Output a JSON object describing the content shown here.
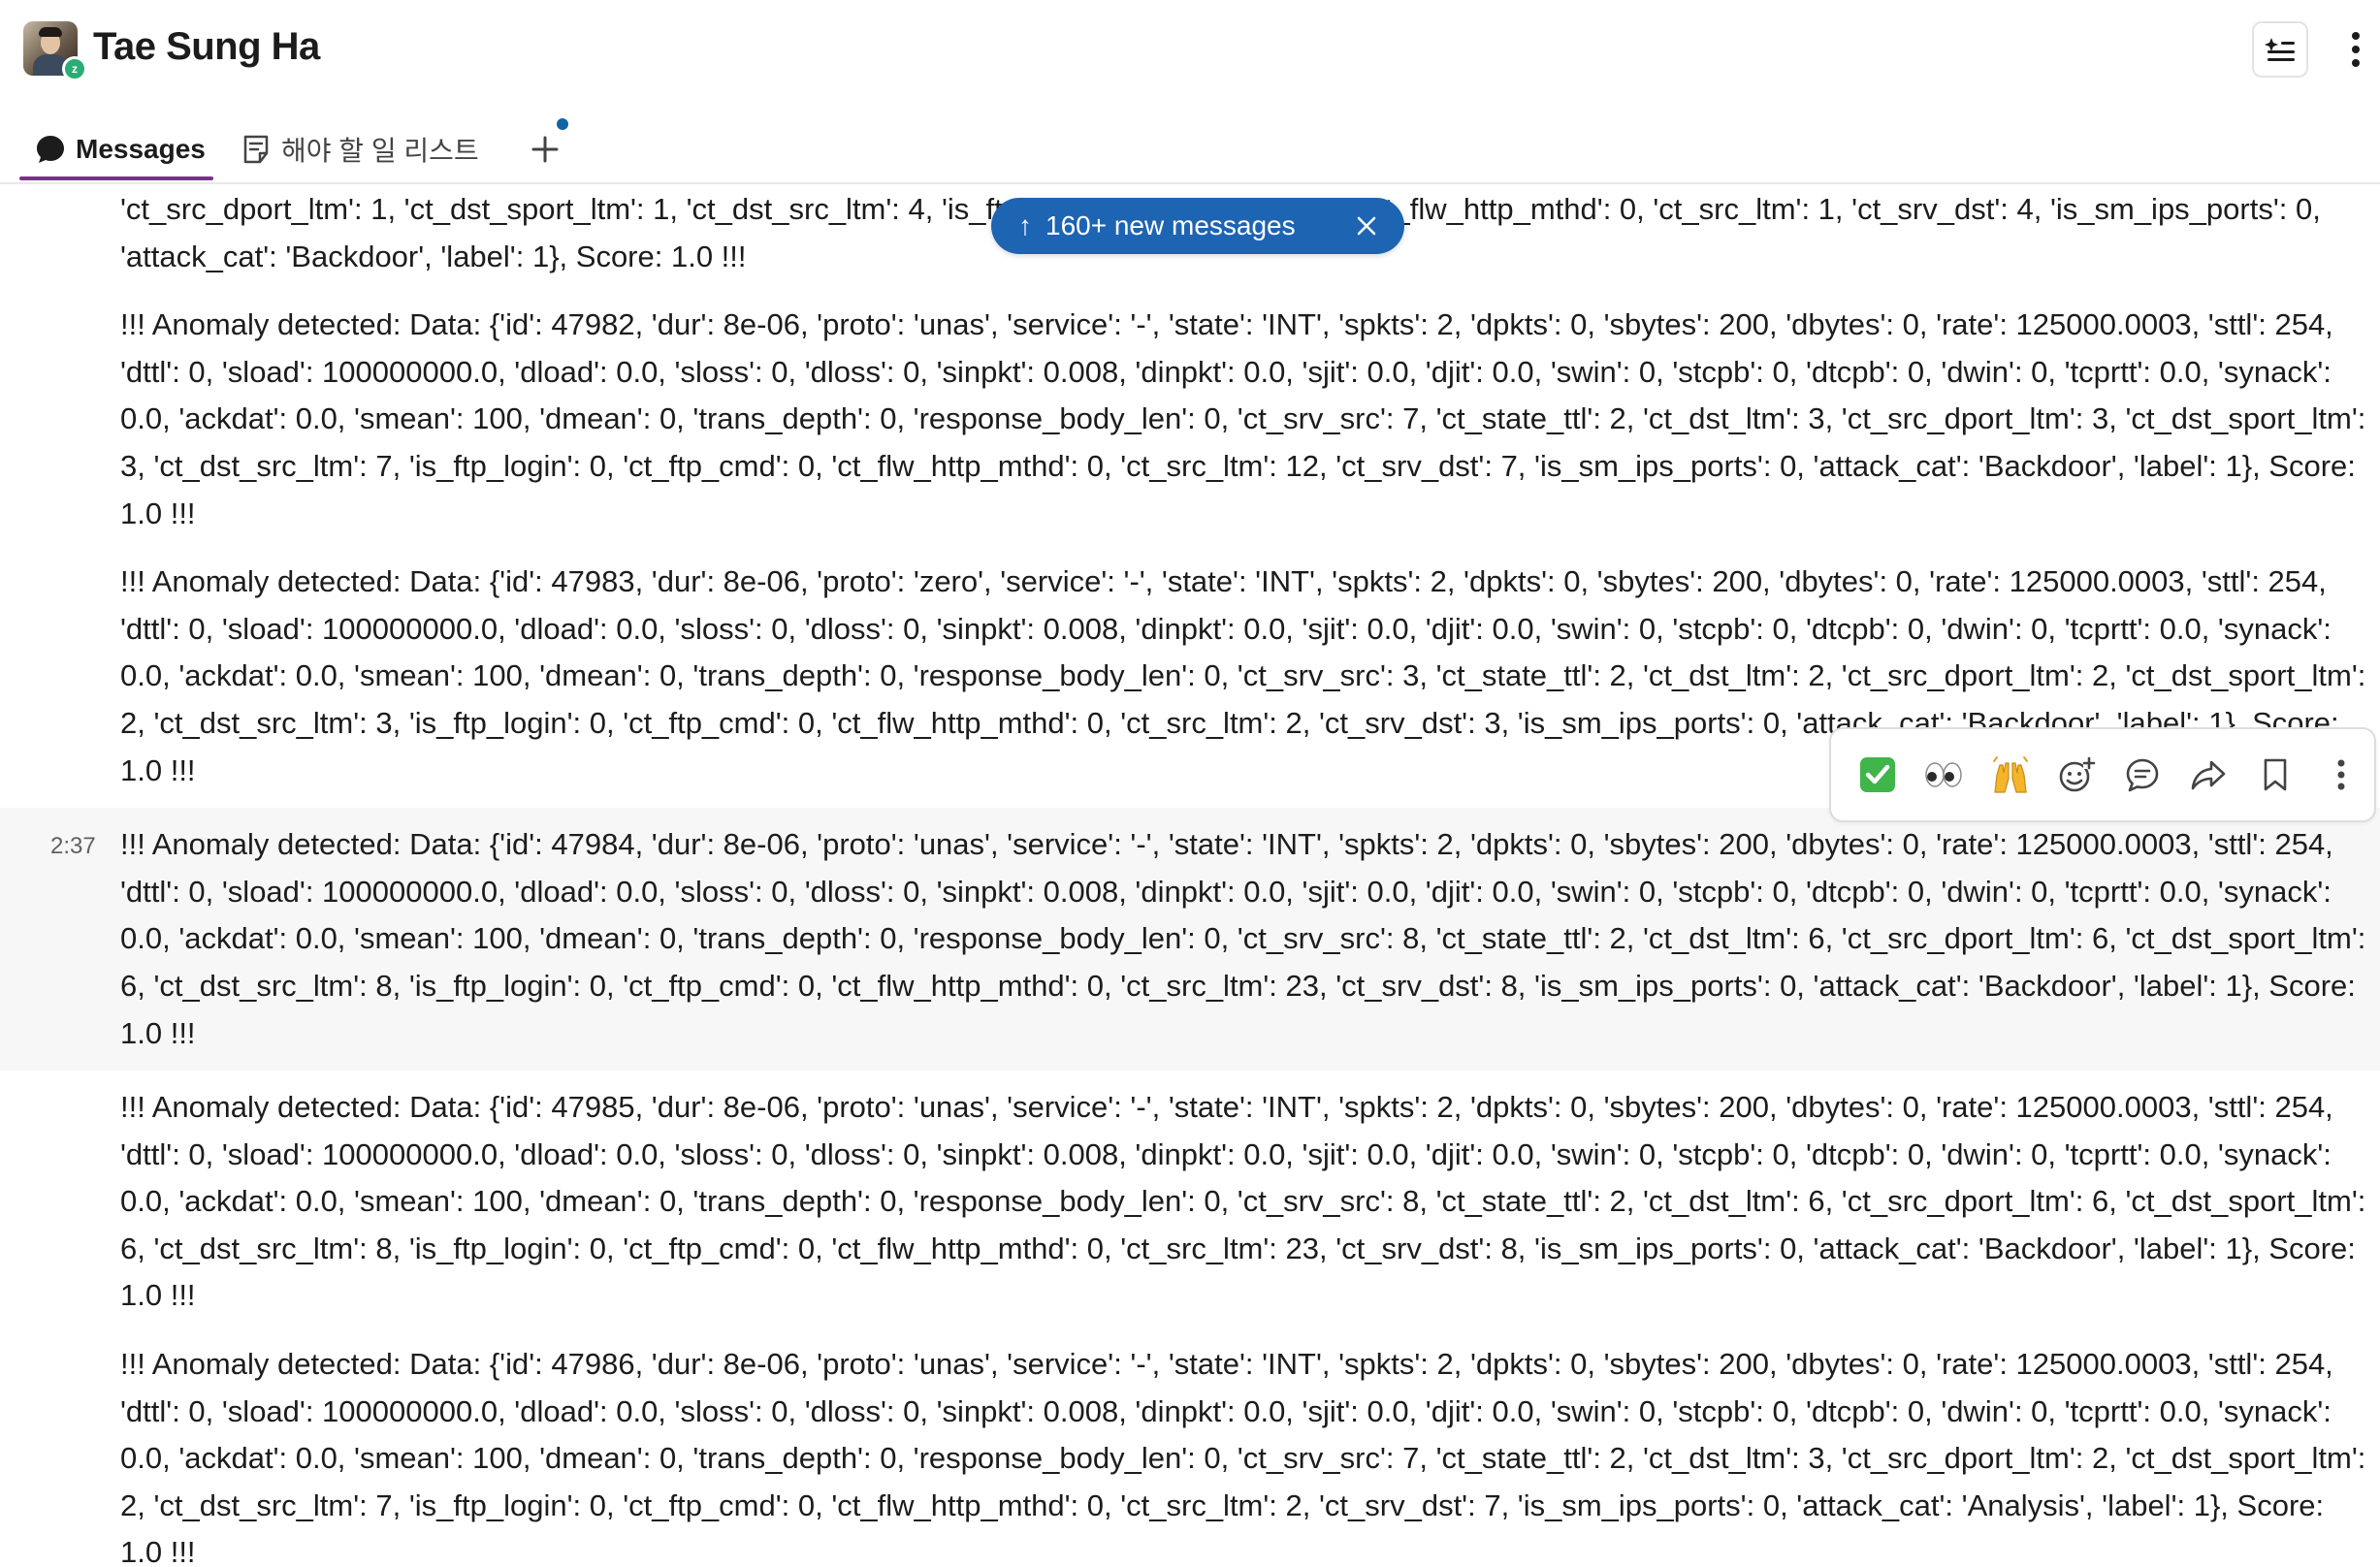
{
  "header": {
    "title": "Tae Sung Ha",
    "avatar_icon": "user-avatar",
    "status_badge": "z"
  },
  "tabs": {
    "messages_label": "Messages",
    "todo_label": "해야 할 일 리스트",
    "add_icon": "plus-icon"
  },
  "new_messages_pill": {
    "label": "160+ new messages"
  },
  "messages": [
    {
      "timestamp": "",
      "text": "'ct_src_dport_ltm': 1, 'ct_dst_sport_ltm': 1, 'ct_dst_src_ltm': 4, 'is_ftp_login': 0, 'ct_ftp_cmd': 0, 'ct_flw_http_mthd': 0, 'ct_src_ltm': 1, 'ct_srv_dst': 4, 'is_sm_ips_ports': 0, 'attack_cat': 'Backdoor', 'label': 1}, Score: 1.0 !!!"
    },
    {
      "timestamp": "",
      "text": "!!! Anomaly detected: Data: {'id': 47982, 'dur': 8e-06, 'proto': 'unas', 'service': '-', 'state': 'INT', 'spkts': 2, 'dpkts': 0, 'sbytes': 200, 'dbytes': 0, 'rate': 125000.0003, 'sttl': 254, 'dttl': 0, 'sload': 100000000.0, 'dload': 0.0, 'sloss': 0, 'dloss': 0, 'sinpkt': 0.008, 'dinpkt': 0.0, 'sjit': 0.0, 'djit': 0.0, 'swin': 0, 'stcpb': 0, 'dtcpb': 0, 'dwin': 0, 'tcprtt': 0.0, 'synack': 0.0, 'ackdat': 0.0, 'smean': 100, 'dmean': 0, 'trans_depth': 0, 'response_body_len': 0, 'ct_srv_src': 7, 'ct_state_ttl': 2, 'ct_dst_ltm': 3, 'ct_src_dport_ltm': 3, 'ct_dst_sport_ltm': 3, 'ct_dst_src_ltm': 7, 'is_ftp_login': 0, 'ct_ftp_cmd': 0, 'ct_flw_http_mthd': 0, 'ct_src_ltm': 12, 'ct_srv_dst': 7, 'is_sm_ips_ports': 0, 'attack_cat': 'Backdoor', 'label': 1}, Score: 1.0 !!!"
    },
    {
      "timestamp": "",
      "text": "!!! Anomaly detected: Data: {'id': 47983, 'dur': 8e-06, 'proto': 'zero', 'service': '-', 'state': 'INT', 'spkts': 2, 'dpkts': 0, 'sbytes': 200, 'dbytes': 0, 'rate': 125000.0003, 'sttl': 254, 'dttl': 0, 'sload': 100000000.0, 'dload': 0.0, 'sloss': 0, 'dloss': 0, 'sinpkt': 0.008, 'dinpkt': 0.0, 'sjit': 0.0, 'djit': 0.0, 'swin': 0, 'stcpb': 0, 'dtcpb': 0, 'dwin': 0, 'tcprtt': 0.0, 'synack': 0.0, 'ackdat': 0.0, 'smean': 100, 'dmean': 0, 'trans_depth': 0, 'response_body_len': 0, 'ct_srv_src': 3, 'ct_state_ttl': 2, 'ct_dst_ltm': 2, 'ct_src_dport_ltm': 2, 'ct_dst_sport_ltm': 2, 'ct_dst_src_ltm': 3, 'is_ftp_login': 0, 'ct_ftp_cmd': 0, 'ct_flw_http_mthd': 0, 'ct_src_ltm': 2, 'ct_srv_dst': 3, 'is_sm_ips_ports': 0, 'attack_cat': 'Backdoor', 'label': 1}, Score: 1.0 !!!"
    },
    {
      "timestamp": "2:37",
      "text": "!!! Anomaly detected: Data: {'id': 47984, 'dur': 8e-06, 'proto': 'unas', 'service': '-', 'state': 'INT', 'spkts': 2, 'dpkts': 0, 'sbytes': 200, 'dbytes': 0, 'rate': 125000.0003, 'sttl': 254, 'dttl': 0, 'sload': 100000000.0, 'dload': 0.0, 'sloss': 0, 'dloss': 0, 'sinpkt': 0.008, 'dinpkt': 0.0, 'sjit': 0.0, 'djit': 0.0, 'swin': 0, 'stcpb': 0, 'dtcpb': 0, 'dwin': 0, 'tcprtt': 0.0, 'synack': 0.0, 'ackdat': 0.0, 'smean': 100, 'dmean': 0, 'trans_depth': 0, 'response_body_len': 0, 'ct_srv_src': 8, 'ct_state_ttl': 2, 'ct_dst_ltm': 6, 'ct_src_dport_ltm': 6, 'ct_dst_sport_ltm': 6, 'ct_dst_src_ltm': 8, 'is_ftp_login': 0, 'ct_ftp_cmd': 0, 'ct_flw_http_mthd': 0, 'ct_src_ltm': 23, 'ct_srv_dst': 8, 'is_sm_ips_ports': 0, 'attack_cat': 'Backdoor', 'label': 1}, Score: 1.0 !!!"
    },
    {
      "timestamp": "",
      "text": "!!! Anomaly detected: Data: {'id': 47985, 'dur': 8e-06, 'proto': 'unas', 'service': '-', 'state': 'INT', 'spkts': 2, 'dpkts': 0, 'sbytes': 200, 'dbytes': 0, 'rate': 125000.0003, 'sttl': 254, 'dttl': 0, 'sload': 100000000.0, 'dload': 0.0, 'sloss': 0, 'dloss': 0, 'sinpkt': 0.008, 'dinpkt': 0.0, 'sjit': 0.0, 'djit': 0.0, 'swin': 0, 'stcpb': 0, 'dtcpb': 0, 'dwin': 0, 'tcprtt': 0.0, 'synack': 0.0, 'ackdat': 0.0, 'smean': 100, 'dmean': 0, 'trans_depth': 0, 'response_body_len': 0, 'ct_srv_src': 8, 'ct_state_ttl': 2, 'ct_dst_ltm': 6, 'ct_src_dport_ltm': 6, 'ct_dst_sport_ltm': 6, 'ct_dst_src_ltm': 8, 'is_ftp_login': 0, 'ct_ftp_cmd': 0, 'ct_flw_http_mthd': 0, 'ct_src_ltm': 23, 'ct_srv_dst': 8, 'is_sm_ips_ports': 0, 'attack_cat': 'Backdoor', 'label': 1}, Score: 1.0 !!!"
    },
    {
      "timestamp": "",
      "text": "!!! Anomaly detected: Data: {'id': 47986, 'dur': 8e-06, 'proto': 'unas', 'service': '-', 'state': 'INT', 'spkts': 2, 'dpkts': 0, 'sbytes': 200, 'dbytes': 0, 'rate': 125000.0003, 'sttl': 254, 'dttl': 0, 'sload': 100000000.0, 'dload': 0.0, 'sloss': 0, 'dloss': 0, 'sinpkt': 0.008, 'dinpkt': 0.0, 'sjit': 0.0, 'djit': 0.0, 'swin': 0, 'stcpb': 0, 'dtcpb': 0, 'dwin': 0, 'tcprtt': 0.0, 'synack': 0.0, 'ackdat': 0.0, 'smean': 100, 'dmean': 0, 'trans_depth': 0, 'response_body_len': 0, 'ct_srv_src': 7, 'ct_state_ttl': 2, 'ct_dst_ltm': 3, 'ct_src_dport_ltm': 2, 'ct_dst_sport_ltm': 2, 'ct_dst_src_ltm': 7, 'is_ftp_login': 0, 'ct_ftp_cmd': 0, 'ct_flw_http_mthd': 0, 'ct_src_ltm': 2, 'ct_srv_dst': 7, 'is_sm_ips_ports': 0, 'attack_cat': 'Analysis', 'label': 1}, Score: 1.0 !!!"
    }
  ],
  "action_bar": {
    "actions": [
      "check-mark-reaction",
      "eyes-reaction",
      "raised-hands-reaction",
      "add-reaction-icon",
      "reply-in-thread-icon",
      "forward-icon",
      "save-bookmark-icon",
      "more-actions-icon"
    ]
  },
  "colors": {
    "accent": "#7c3085",
    "pill": "#1d64b3",
    "hover_row": "#f7f7f7",
    "text": "#1d1c1d"
  }
}
